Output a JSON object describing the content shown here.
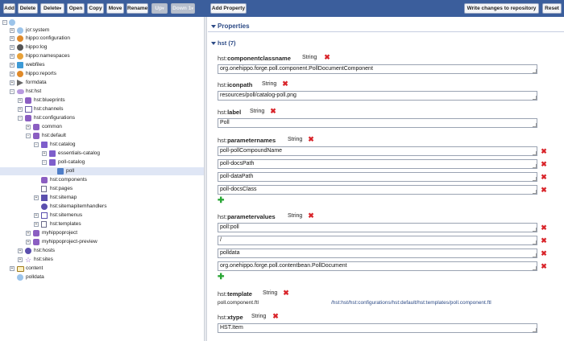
{
  "toolbar": {
    "add": "Add",
    "delete": "Delete",
    "delete_menu": "Delete",
    "open": "Open",
    "copy": "Copy",
    "move": "Move",
    "rename": "Rename",
    "up": "Up",
    "down": "Down",
    "down_count": "1",
    "add_property": "Add Property",
    "write_changes": "Write changes to repository",
    "reset": "Reset"
  },
  "tree": {
    "jcr_system": "jcr:system",
    "hippo_configuration": "hippo:configuration",
    "hippo_log": "hippo:log",
    "hippo_namespaces": "hippo:namespaces",
    "webfiles": "webfiles",
    "hippo_reports": "hippo:reports",
    "formdata": "formdata",
    "hst_hst": "hst:hst",
    "hst_blueprints": "hst:blueprints",
    "hst_channels": "hst:channels",
    "hst_configurations": "hst:configurations",
    "common": "common",
    "hst_default": "hst:default",
    "hst_catalog": "hst:catalog",
    "essentials_catalog": "essentials-catalog",
    "poll_catalog": "poll-catalog",
    "poll": "poll",
    "hst_components": "hst:components",
    "hst_pages": "hst:pages",
    "hst_sitemap": "hst:sitemap",
    "hst_sitemapitemhandlers": "hst:sitemapitemhandlers",
    "hst_sitemenus": "hst:sitemenus",
    "hst_templates": "hst:templates",
    "myhippoproject": "myhippoproject",
    "myhippoproject_preview": "myhippoproject-preview",
    "hst_hosts": "hst:hosts",
    "hst_sites": "hst:sites",
    "content": "content",
    "polldata": "polldata"
  },
  "properties": {
    "title": "Properties",
    "group_title": "hst (7)",
    "componentclassname": {
      "ns": "hst:",
      "name": "componentclassname",
      "type": "String",
      "value": "org.onehippo.forge.poll.component.PollDocumentComponent"
    },
    "iconpath": {
      "ns": "hst:",
      "name": "iconpath",
      "type": "String",
      "value": "resources/poll/catalog-poll.png"
    },
    "label": {
      "ns": "hst:",
      "name": "label",
      "type": "String",
      "value": "Poll"
    },
    "parameternames": {
      "ns": "hst:",
      "name": "parameternames",
      "type": "String",
      "values": [
        "poll-pollCompoundName",
        "poll-docsPath",
        "poll-dataPath",
        "poll-docsClass"
      ]
    },
    "parametervalues": {
      "ns": "hst:",
      "name": "parametervalues",
      "type": "String",
      "values": [
        "poll:poll",
        "/",
        "polldata",
        "org.onehippo.forge.poll.contentbean.PollDocument"
      ]
    },
    "template": {
      "ns": "hst:",
      "name": "template",
      "type": "String",
      "value": "poll.component.ftl",
      "link": "/hst:hst/hst:configurations/hst:default/hst:templates/poll.component.ftl"
    },
    "xtype": {
      "ns": "hst:",
      "name": "xtype",
      "type": "String",
      "value": "HST.Item"
    }
  },
  "colors": {
    "toolbar": "#3b5e9c",
    "accent": "#2d4b86",
    "delete": "#d9252b",
    "add": "#2aa636",
    "selection": "#dfe6f5"
  }
}
